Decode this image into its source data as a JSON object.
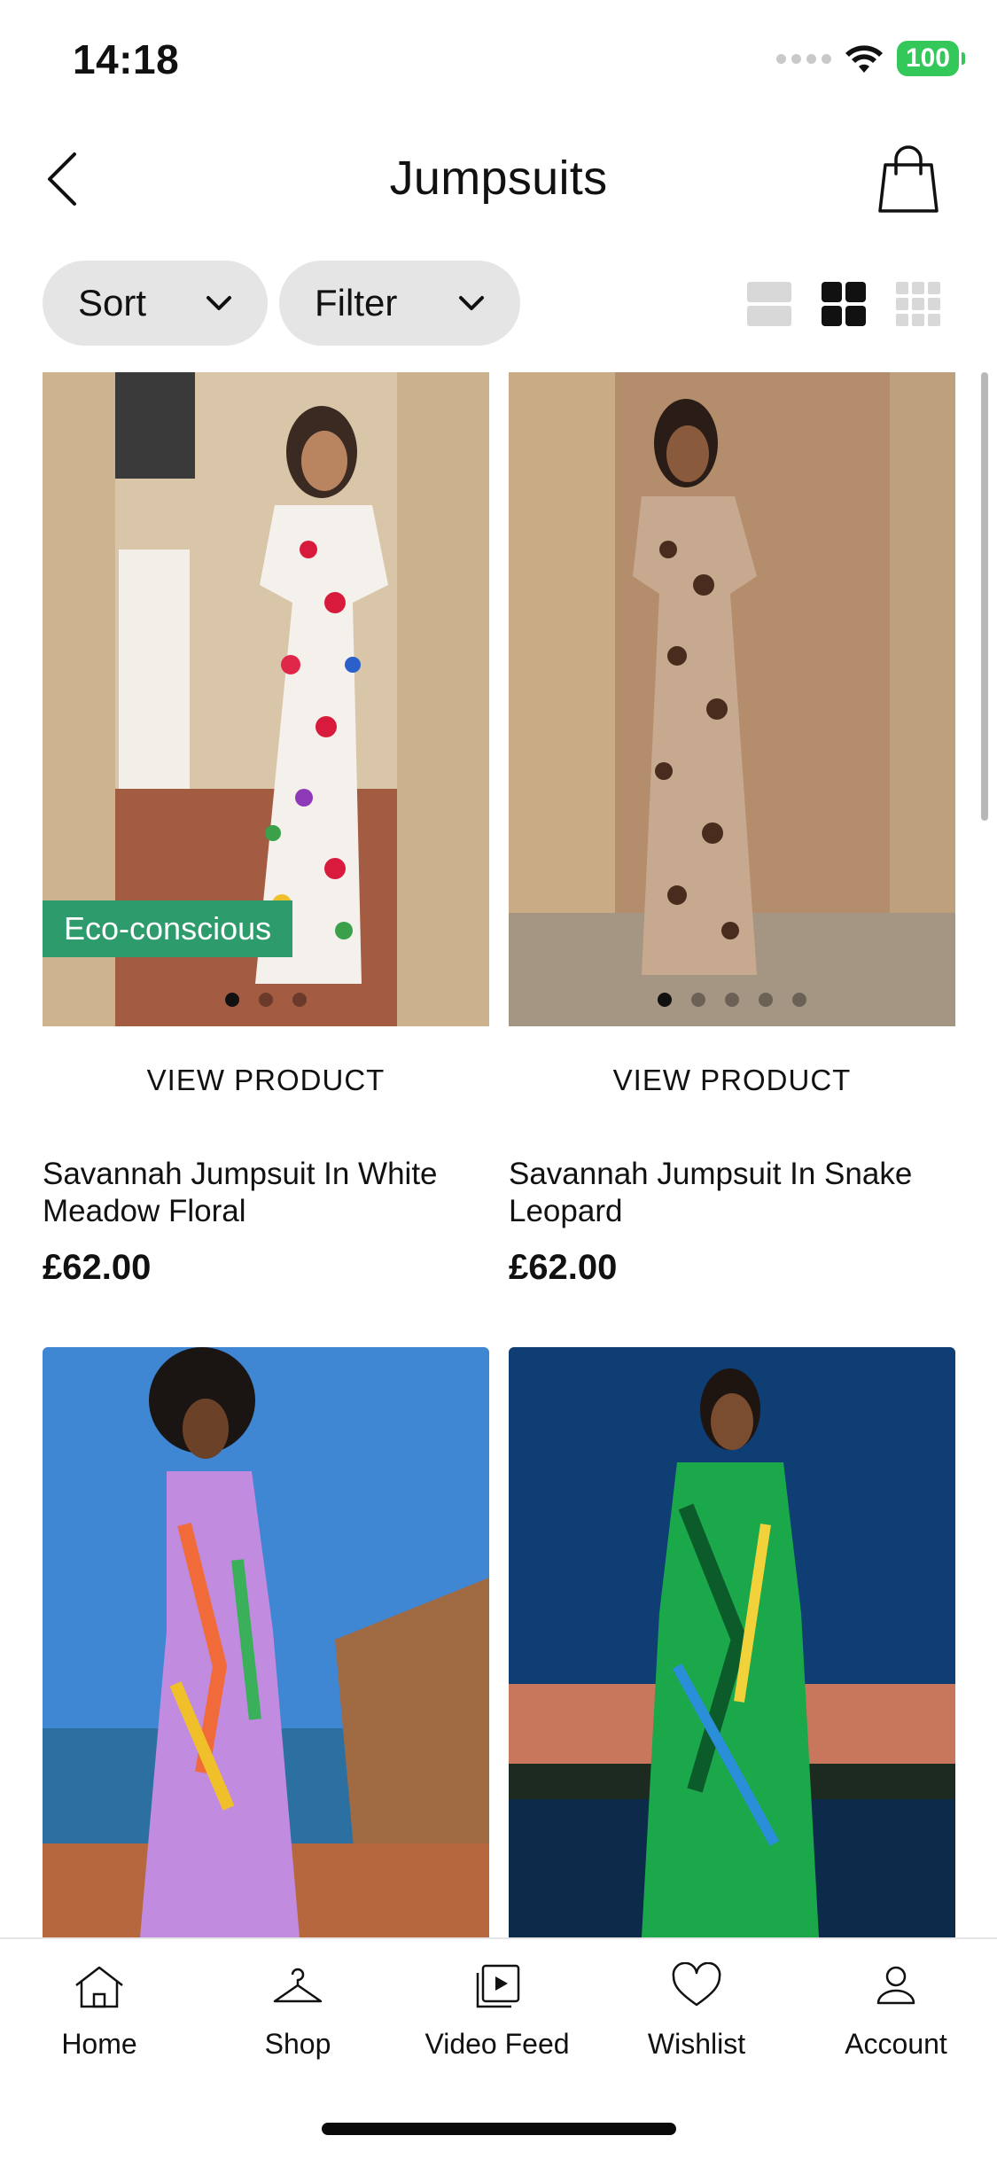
{
  "status_bar": {
    "time": "14:18",
    "battery": "100"
  },
  "header": {
    "title": "Jumpsuits"
  },
  "toolbar": {
    "sort_label": "Sort",
    "filter_label": "Filter"
  },
  "products": [
    {
      "name": "Savannah Jumpsuit In White Meadow Floral",
      "price": "£62.00",
      "cta": "VIEW PRODUCT",
      "badge": "Eco-conscious"
    },
    {
      "name": "Savannah Jumpsuit In Snake Leopard",
      "price": "£62.00",
      "cta": "VIEW PRODUCT"
    },
    {
      "name": "",
      "price": ""
    },
    {
      "name": "",
      "price": ""
    }
  ],
  "tab_bar": {
    "items": [
      {
        "label": "Home",
        "icon": "home-icon"
      },
      {
        "label": "Shop",
        "icon": "hanger-icon"
      },
      {
        "label": "Video Feed",
        "icon": "video-feed-icon"
      },
      {
        "label": "Wishlist",
        "icon": "heart-icon"
      },
      {
        "label": "Account",
        "icon": "account-icon"
      }
    ]
  },
  "colors": {
    "badge_eco": "#2e9b6d",
    "pill_bg": "#e5e5e5",
    "battery": "#34c759"
  }
}
